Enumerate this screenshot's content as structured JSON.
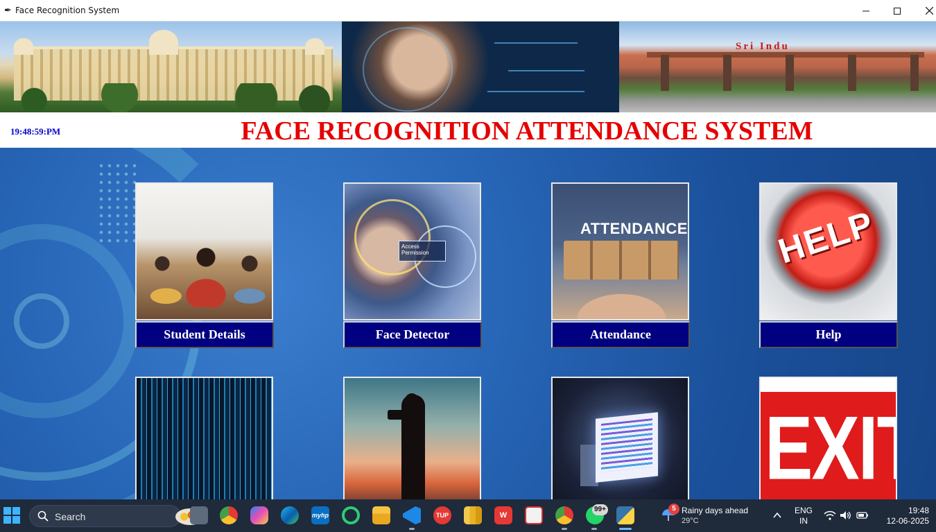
{
  "window": {
    "title": "Face Recognition System"
  },
  "header": {
    "clock": "19:48:59:PM",
    "title": "FACE RECOGNITION ATTENDANCE SYSTEM"
  },
  "banner": {
    "gate_sign": "Sri Indu"
  },
  "tiles": [
    {
      "label": "Student Details"
    },
    {
      "label": "Face Detector"
    },
    {
      "label": "Attendance",
      "image_text": "ATTENDANCE"
    },
    {
      "label": "Help",
      "image_text": "HELP"
    },
    {
      "label": ""
    },
    {
      "label": ""
    },
    {
      "label": ""
    },
    {
      "label": "",
      "image_text": "EXIT"
    }
  ],
  "face_detector_card": "Access Permission",
  "taskbar": {
    "search_placeholder": "Search",
    "apps": [
      {
        "name": "task-view",
        "label": ""
      },
      {
        "name": "chrome",
        "label": ""
      },
      {
        "name": "copilot",
        "label": ""
      },
      {
        "name": "edge",
        "label": ""
      },
      {
        "name": "myhp",
        "label": "myhp"
      },
      {
        "name": "circle-app",
        "label": ""
      },
      {
        "name": "file-explorer",
        "label": ""
      },
      {
        "name": "vscode",
        "label": ""
      },
      {
        "name": "tup",
        "label": "TUP"
      },
      {
        "name": "power-bi",
        "label": ""
      },
      {
        "name": "wps",
        "label": "W"
      },
      {
        "name": "snipping-tool",
        "label": ""
      },
      {
        "name": "chrome-profile",
        "label": ""
      },
      {
        "name": "whatsapp",
        "label": ""
      },
      {
        "name": "python",
        "label": ""
      }
    ],
    "whatsapp_badge": "99+",
    "weather_badge": "5",
    "weather_title": "Rainy days ahead",
    "weather_temp": "29°C",
    "lang_line1": "ENG",
    "lang_line2": "IN",
    "time": "19:48",
    "date": "12-06-2025"
  },
  "colors": {
    "title_red": "#e60000",
    "clock_blue": "#0000cc",
    "button_navy": "#000080",
    "taskbar_bg": "#1f2a3b"
  }
}
